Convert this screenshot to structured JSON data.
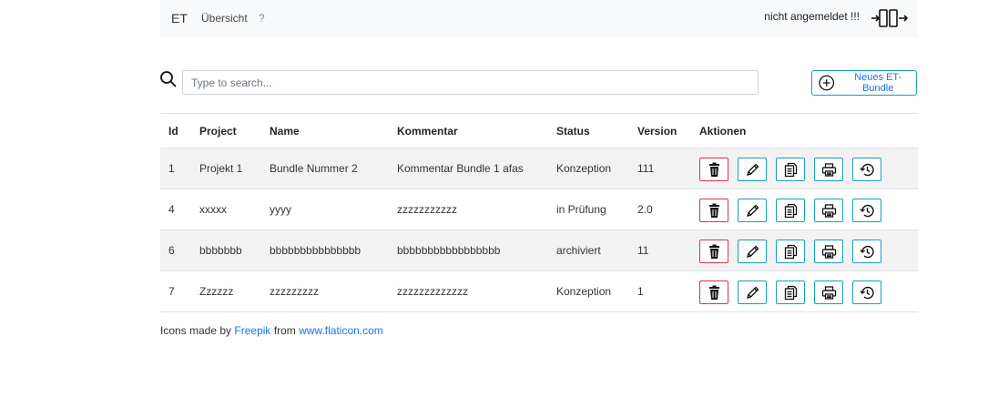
{
  "nav": {
    "brand": "ET",
    "overview_link": "Übersicht",
    "help": "?",
    "login_status": "nicht angemeldet !!!",
    "login_icon": "login-door-icon"
  },
  "search": {
    "placeholder": "Type to search...",
    "value": "",
    "icon": "search-icon"
  },
  "new_bundle_button": {
    "label": "Neues ET-Bundle",
    "icon": "plus-circle-icon"
  },
  "table": {
    "headers": [
      "Id",
      "Project",
      "Name",
      "Kommentar",
      "Status",
      "Version",
      "Aktionen"
    ],
    "rows": [
      {
        "id": "1",
        "project": "Projekt 1",
        "name": "Bundle Nummer 2",
        "comment": "Kommentar Bundle 1 afas",
        "status": "Konzeption",
        "version": "111"
      },
      {
        "id": "4",
        "project": "xxxxx",
        "name": "yyyy",
        "comment": "zzzzzzzzzzz",
        "status": "in Prüfung",
        "version": "2.0"
      },
      {
        "id": "6",
        "project": "bbbbbbb",
        "name": "bbbbbbbbbbbbbbb",
        "comment": "bbbbbbbbbbbbbbbbb",
        "status": "archiviert",
        "version": "11"
      },
      {
        "id": "7",
        "project": "Zzzzzz",
        "name": "zzzzzzzzz",
        "comment": "zzzzzzzzzzzzz",
        "status": "Konzeption",
        "version": "1"
      }
    ],
    "action_icons": [
      "trash-icon",
      "pencil-icon",
      "copy-icon",
      "printer-icon",
      "history-icon"
    ]
  },
  "colors": {
    "accent": "#17a2b8",
    "danger": "#dc3545",
    "link": "#1a73e8",
    "navbar_bg": "#f8f9fa",
    "stripe": "#f2f2f2"
  },
  "footer": {
    "prefix": "Icons made by",
    "author": "Freepik",
    "middle": "from",
    "site": "www.flaticon.com"
  }
}
